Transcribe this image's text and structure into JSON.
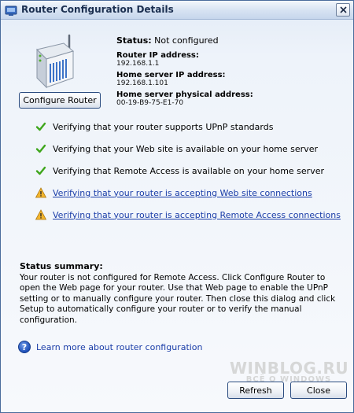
{
  "window": {
    "title": "Router Configuration Details"
  },
  "router_info": {
    "status_label": "Status:",
    "status_value": "Not configured",
    "router_ip_label": "Router IP address:",
    "router_ip_value": "192.168.1.1",
    "server_ip_label": "Home server IP address:",
    "server_ip_value": "192.168.1.101",
    "server_mac_label": "Home server physical address:",
    "server_mac_value": "00-19-B9-75-E1-70",
    "configure_button": "Configure Router"
  },
  "checks": [
    {
      "status": "ok",
      "icon": "check-icon",
      "text": "Verifying that your router supports UPnP standards",
      "is_link": false
    },
    {
      "status": "ok",
      "icon": "check-icon",
      "text": "Verifying that your Web site is available on your home server",
      "is_link": false
    },
    {
      "status": "ok",
      "icon": "check-icon",
      "text": "Verifying that Remote Access is available on your home server",
      "is_link": false
    },
    {
      "status": "warning",
      "icon": "warning-icon",
      "text": "Verifying that your router is accepting Web site connections",
      "is_link": true
    },
    {
      "status": "warning",
      "icon": "warning-icon",
      "text": "Verifying that your router is accepting Remote Access connections",
      "is_link": true
    }
  ],
  "summary": {
    "title": "Status summary:",
    "text": "Your router is not configured for Remote Access. Click Configure Router to open the Web page for your router. Use that Web page to enable the UPnP setting or to manually configure your router. Then close this dialog and click Setup to automatically configure your router or to verify the manual configuration."
  },
  "help": {
    "icon": "help-icon",
    "link_text": "Learn more about router configuration"
  },
  "footer": {
    "refresh_button": "Refresh",
    "close_button": "Close"
  },
  "watermark": {
    "main": "WINBLOG.RU",
    "sub": "ВСЁ О WINDOWS"
  },
  "colors": {
    "ok": "#3fa61c",
    "warning": "#e8a21b",
    "link": "#1a3da8"
  }
}
